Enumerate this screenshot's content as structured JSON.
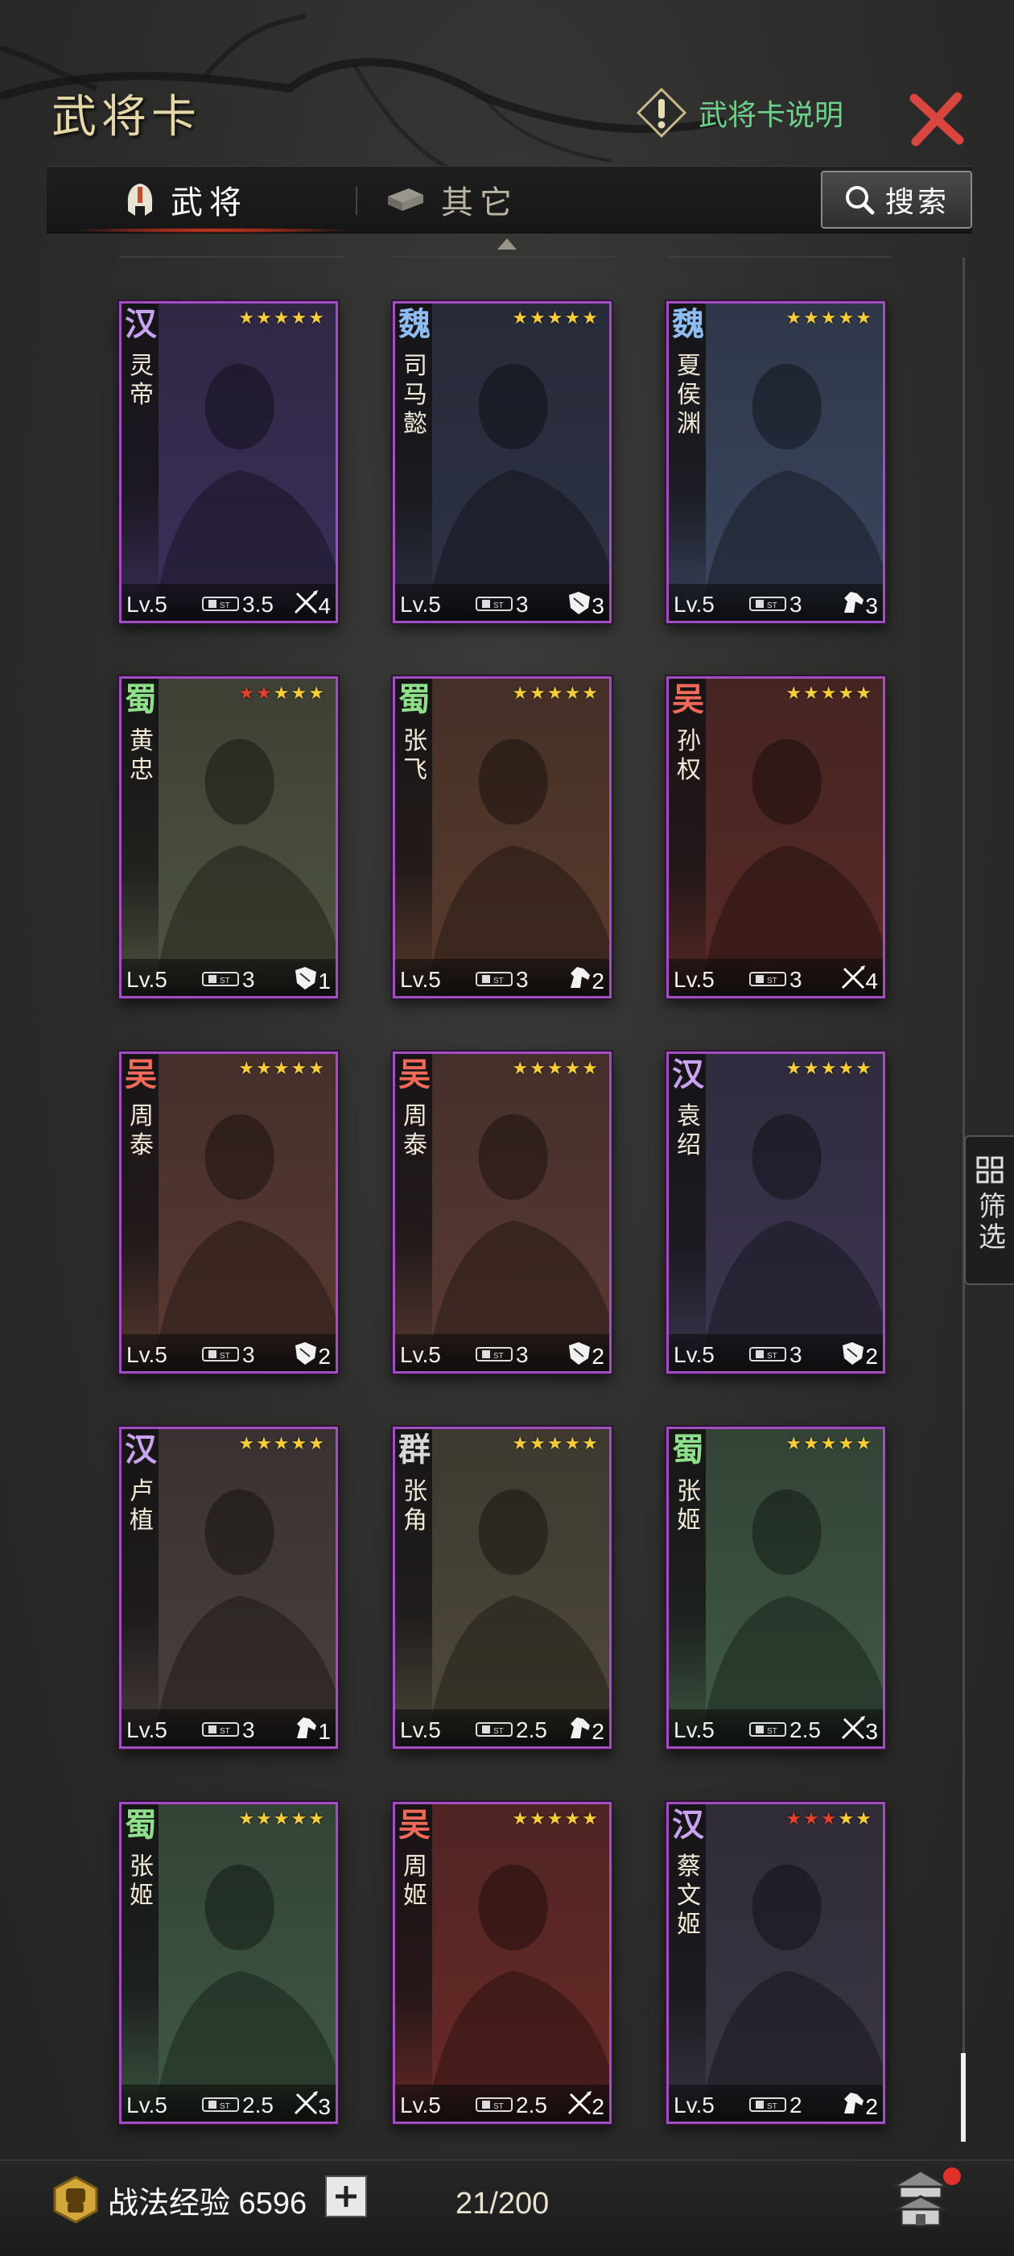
{
  "header": {
    "title": "武将卡",
    "help_label": "武将卡说明"
  },
  "tabs": [
    {
      "label": "武将",
      "active": true
    },
    {
      "label": "其它",
      "active": false
    }
  ],
  "search": {
    "label": "搜索"
  },
  "filter": {
    "label": "筛选"
  },
  "colors": {
    "accent_green": "#6fd08c",
    "close_red": "#d9463f",
    "card_border": "#a24ec0",
    "star_gold": "#f5cc3a",
    "star_red": "#e0402c"
  },
  "cards": [
    {
      "faction": "汉",
      "name": "灵帝",
      "stars_red": 0,
      "level": "Lv.5",
      "cost": "3.5",
      "arms": "4",
      "arms_icon": "crossbow-icon",
      "hue": "#3b2f5a"
    },
    {
      "faction": "魏",
      "name": "司马懿",
      "stars_red": 0,
      "level": "Lv.5",
      "cost": "3",
      "arms": "3",
      "arms_icon": "shield-icon",
      "hue": "#2d3346"
    },
    {
      "faction": "魏",
      "name": "夏侯渊",
      "stars_red": 0,
      "level": "Lv.5",
      "cost": "3",
      "arms": "3",
      "arms_icon": "horse-icon",
      "hue": "#3a4660"
    },
    {
      "faction": "蜀",
      "name": "黄忠",
      "stars_red": 2,
      "level": "Lv.5",
      "cost": "3",
      "arms": "1",
      "arms_icon": "shield-icon",
      "hue": "#4f5540"
    },
    {
      "faction": "蜀",
      "name": "张飞",
      "stars_red": 0,
      "level": "Lv.5",
      "cost": "3",
      "arms": "2",
      "arms_icon": "horse-icon",
      "hue": "#5a3b2c"
    },
    {
      "faction": "吴",
      "name": "孙权",
      "stars_red": 0,
      "level": "Lv.5",
      "cost": "3",
      "arms": "4",
      "arms_icon": "crossbow-icon",
      "hue": "#5a2a25"
    },
    {
      "faction": "吴",
      "name": "周泰",
      "stars_red": 0,
      "level": "Lv.5",
      "cost": "3",
      "arms": "2",
      "arms_icon": "shield-icon",
      "hue": "#5b3a32"
    },
    {
      "faction": "吴",
      "name": "周泰",
      "stars_red": 0,
      "level": "Lv.5",
      "cost": "3",
      "arms": "2",
      "arms_icon": "shield-icon",
      "hue": "#5b3a32"
    },
    {
      "faction": "汉",
      "name": "袁绍",
      "stars_red": 0,
      "level": "Lv.5",
      "cost": "3",
      "arms": "2",
      "arms_icon": "shield-icon",
      "hue": "#3c3550"
    },
    {
      "faction": "汉",
      "name": "卢植",
      "stars_red": 0,
      "level": "Lv.5",
      "cost": "3",
      "arms": "1",
      "arms_icon": "horse-icon",
      "hue": "#4a3f3c"
    },
    {
      "faction": "群",
      "name": "张角",
      "stars_red": 0,
      "level": "Lv.5",
      "cost": "2.5",
      "arms": "2",
      "arms_icon": "horse-icon",
      "hue": "#4f4a3a"
    },
    {
      "faction": "蜀",
      "name": "张姬",
      "stars_red": 0,
      "level": "Lv.5",
      "cost": "2.5",
      "arms": "3",
      "arms_icon": "crossbow-icon",
      "hue": "#3f5a44"
    },
    {
      "faction": "蜀",
      "name": "张姬",
      "stars_red": 0,
      "level": "Lv.5",
      "cost": "2.5",
      "arms": "3",
      "arms_icon": "crossbow-icon",
      "hue": "#3f5a44"
    },
    {
      "faction": "吴",
      "name": "周姬",
      "stars_red": 0,
      "level": "Lv.5",
      "cost": "2.5",
      "arms": "2",
      "arms_icon": "crossbow-icon",
      "hue": "#6a2a26"
    },
    {
      "faction": "汉",
      "name": "蔡文姬",
      "stars_red": 3,
      "level": "Lv.5",
      "cost": "2",
      "arms": "2",
      "arms_icon": "horse-icon",
      "hue": "#3a3645"
    }
  ],
  "footer": {
    "exp_label": "战法经验 6596",
    "count": "21/200"
  }
}
